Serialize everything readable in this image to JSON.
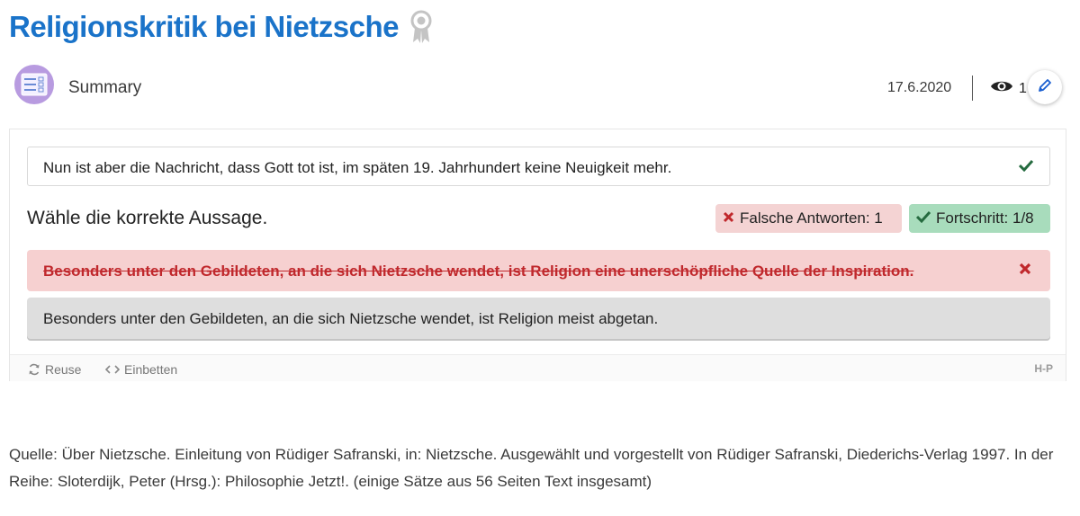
{
  "page": {
    "title": "Religionskritik bei Nietzsche",
    "title_color": "#1a73c9"
  },
  "meta": {
    "content_type": "Summary",
    "date": "17.6.2020",
    "views": "1"
  },
  "h5p": {
    "statement": "Nun ist aber die Nachricht, dass Gott tot ist, im späten 19. Jahrhundert keine Neuigkeit mehr.",
    "question": "Wähle die korrekte Aussage.",
    "wrong_answers": "Falsche Antworten: 1",
    "progress": "Fortschritt: 1/8",
    "answers": [
      {
        "text": "Besonders unter den Gebildeten, an die sich Nietzsche wendet, ist Religion eine unerschöpfliche Quelle der Inspiration.",
        "state": "wrong"
      },
      {
        "text": "Besonders unter den Gebildeten, an die sich Nietzsche wendet, ist Religion meist abgetan.",
        "state": "neutral"
      }
    ],
    "footer": {
      "reuse": "Reuse",
      "embed": "Einbetten",
      "logo": "H-P"
    }
  },
  "source": "Quelle: Über Nietzsche. Einleitung von Rüdiger Safranski, in: Nietzsche. Ausgewählt und vorgestellt von Rüdiger Safranski, Diederichs-Verlag 1997. In der Reihe: Sloterdijk, Peter (Hrsg.): Philosophie Jetzt!. (einige Sätze aus 56 Seiten Text insgesamt)",
  "colors": {
    "accent": "#1a73c9",
    "wrong_bg": "#f6d0d0",
    "wrong_text": "#c0282c",
    "progress_bg": "#a8dcbc",
    "avatar_bg": "#b89be0"
  }
}
